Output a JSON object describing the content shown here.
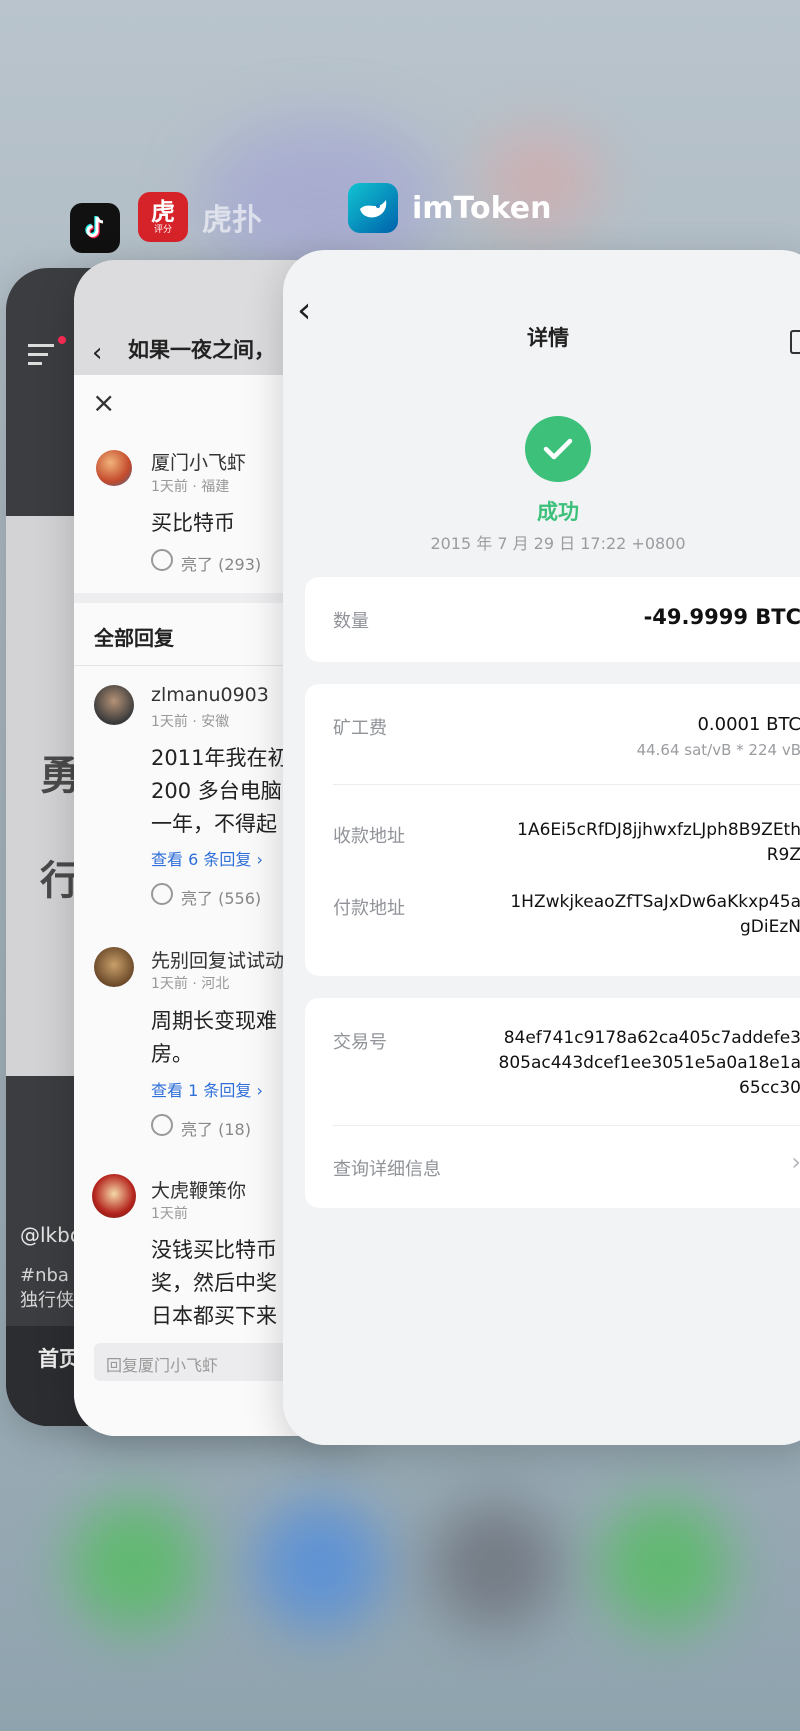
{
  "switcher": {
    "apps": [
      {
        "name": "抖音",
        "icon": "tiktok-icon"
      },
      {
        "name": "虎扑",
        "icon": "hupu-icon",
        "badge": "评分"
      },
      {
        "name": "imToken",
        "icon": "imtoken-icon"
      }
    ]
  },
  "card1": {
    "big_chars": [
      "勇",
      "行"
    ],
    "handle": "@lkbo",
    "tag_line": "#nba 交",
    "sub_line": "独行侠",
    "nav_home": "首页"
  },
  "card2": {
    "title": "如果一夜之间，",
    "main_post": {
      "user": "厦门小飞虾",
      "meta": "1天前 · 福建",
      "text": "买比特币",
      "likes": "亮了 (293)"
    },
    "section_title": "全部回复",
    "replies": [
      {
        "user": "zlmanu0903",
        "meta": "1天前 · 安徽",
        "lines": [
          "2011年我在初",
          "200 多台电脑",
          "一年，不得起"
        ],
        "view_more": "查看 6 条回复",
        "likes": "亮了 (556)"
      },
      {
        "user": "先别回复试试动",
        "meta": "1天前 · 河北",
        "lines": [
          "周期长变现难",
          "房。"
        ],
        "view_more": "查看 1 条回复",
        "likes": "亮了 (18)"
      },
      {
        "user": "大虎鞭策你",
        "meta": "1天前",
        "lines": [
          "没钱买比特币",
          "奖，然后中奖",
          "日本都买下来"
        ]
      }
    ],
    "reply_placeholder": "回复厦门小飞虾"
  },
  "card3": {
    "header_title": "详情",
    "status": "成功",
    "timestamp": "2015 年 7 月 29 日 17:22 +0800",
    "amount_label": "数量",
    "amount_value": "-49.9999 BTC",
    "fee_label": "矿工费",
    "fee_value": "0.0001 BTC",
    "fee_detail": "44.64 sat/vB * 224 vB",
    "to_label": "收款地址",
    "to_value_lines": [
      "1A6Ei5cRfDJ8jjhwxfzLJph8B9ZEth",
      "R9Z"
    ],
    "from_label": "付款地址",
    "from_value_lines": [
      "1HZwkjkeaoZfTSaJxDw6aKkxp45a",
      "gDiEzN"
    ],
    "txid_label": "交易号",
    "txid_value_lines": [
      "84ef741c9178a62ca405c7addefe3",
      "805ac443dcef1ee3051e5a0a18e1a",
      "65cc30"
    ],
    "query_label": "查询详细信息"
  },
  "colors": {
    "success_green": "#3cc07a",
    "link_blue": "#2f6fd8",
    "imtoken_blue": "#1a9ee9"
  }
}
